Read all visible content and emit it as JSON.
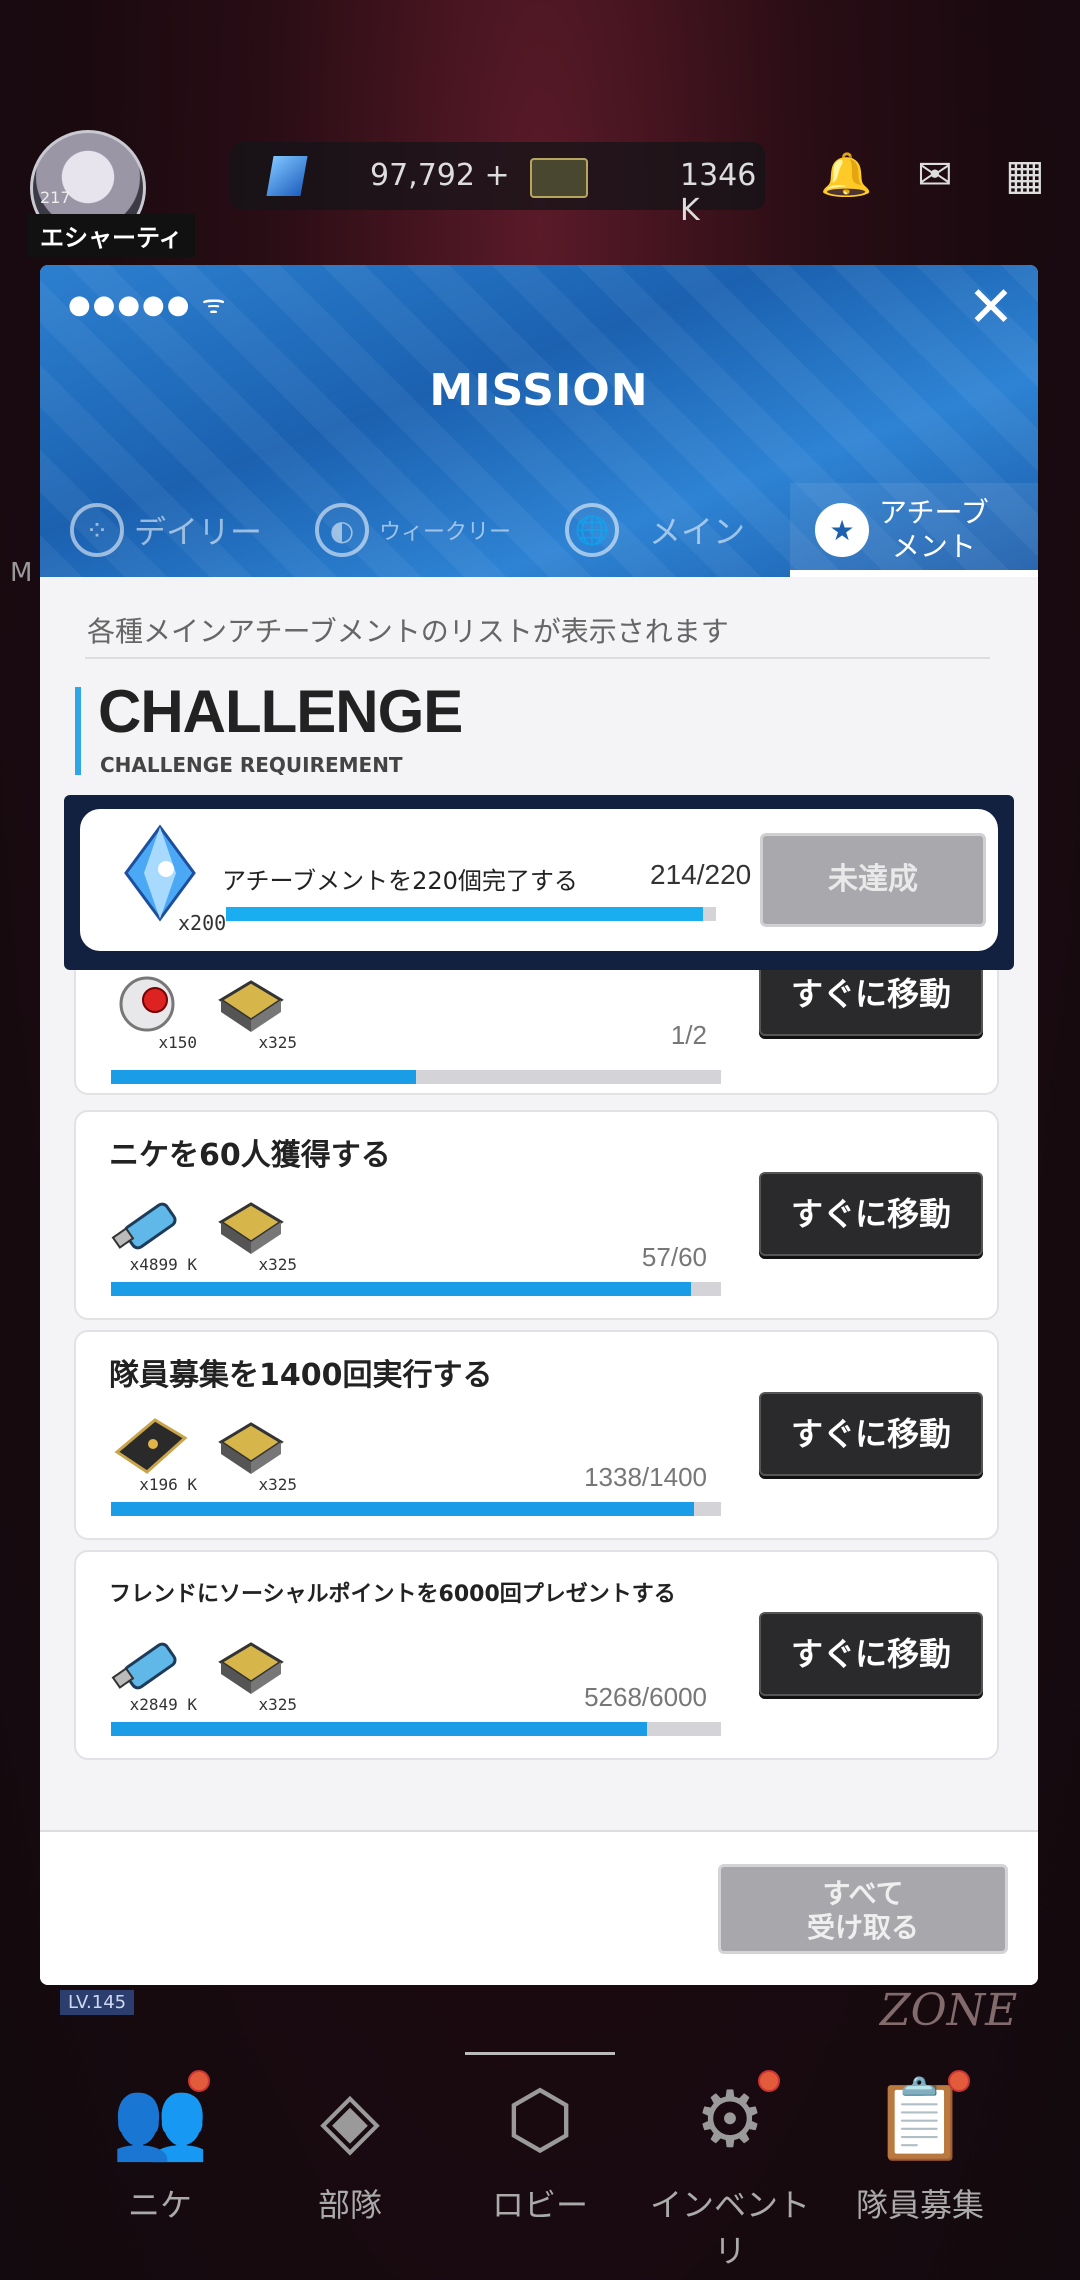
{
  "lobby": {
    "player_name": "エシャーティ",
    "player_level": "217",
    "gems": "97,792",
    "gems_plus": "+",
    "credits": "1346 K",
    "squad_level": "LV.145",
    "zone_label": "ZONE",
    "side_letter": "M"
  },
  "bottom_nav": [
    {
      "label": "ニケ",
      "icon": "people-icon"
    },
    {
      "label": "部隊",
      "icon": "squad-icon"
    },
    {
      "label": "ロビー",
      "icon": "lobby-icon"
    },
    {
      "label": "インベントリ",
      "icon": "inventory-icon"
    },
    {
      "label": "隊員募集",
      "icon": "recruit-icon"
    }
  ],
  "modal": {
    "signal": "●●●●● ᯤ",
    "title": "MISSION",
    "close_symbol": "✕",
    "tabs": [
      {
        "label": "デイリー",
        "icon": "daily-icon",
        "active": false
      },
      {
        "label": "ウィークリー",
        "icon": "weekly-icon",
        "active": false
      },
      {
        "label": "メイン",
        "icon": "globe-icon",
        "active": false
      },
      {
        "label": "アチーブ\nメント",
        "icon": "star-icon",
        "active": true
      }
    ],
    "description": "各種メインアチーブメントのリストが表示されます",
    "section_title": "CHALLENGE",
    "section_subtitle": "CHALLENGE REQUIREMENT",
    "highlight": {
      "title": "アチーブメントを220個完了する",
      "progress": "214/220",
      "progress_value": 0.973,
      "reward_qty": "x200",
      "button": "未達成"
    },
    "partial": {
      "progress": "1/2",
      "progress_value": 0.5,
      "rewards": [
        {
          "qty": "x150"
        },
        {
          "qty": "x325"
        }
      ],
      "button": "すぐに移動"
    },
    "missions": [
      {
        "title": "ニケを60人獲得する",
        "progress": "57/60",
        "progress_value": 0.95,
        "rewards": [
          {
            "qty": "x4899 K"
          },
          {
            "qty": "x325"
          }
        ],
        "button": "すぐに移動"
      },
      {
        "title": "隊員募集を1400回実行する",
        "progress": "1338/1400",
        "progress_value": 0.956,
        "rewards": [
          {
            "qty": "x196 K"
          },
          {
            "qty": "x325"
          }
        ],
        "button": "すぐに移動"
      },
      {
        "title": "フレンドにソーシャルポイントを6000回プレゼントする",
        "progress": "5268/6000",
        "progress_value": 0.878,
        "rewards": [
          {
            "qty": "x2849 K"
          },
          {
            "qty": "x325"
          }
        ],
        "button": "すぐに移動"
      }
    ],
    "claim_all": "すべて\n受け取る"
  },
  "colors": {
    "accent_blue": "#1a9de6",
    "header_blue": "#1b61b0",
    "dark_button": "#2a2a2c",
    "disabled_button": "#a9a9ad"
  }
}
